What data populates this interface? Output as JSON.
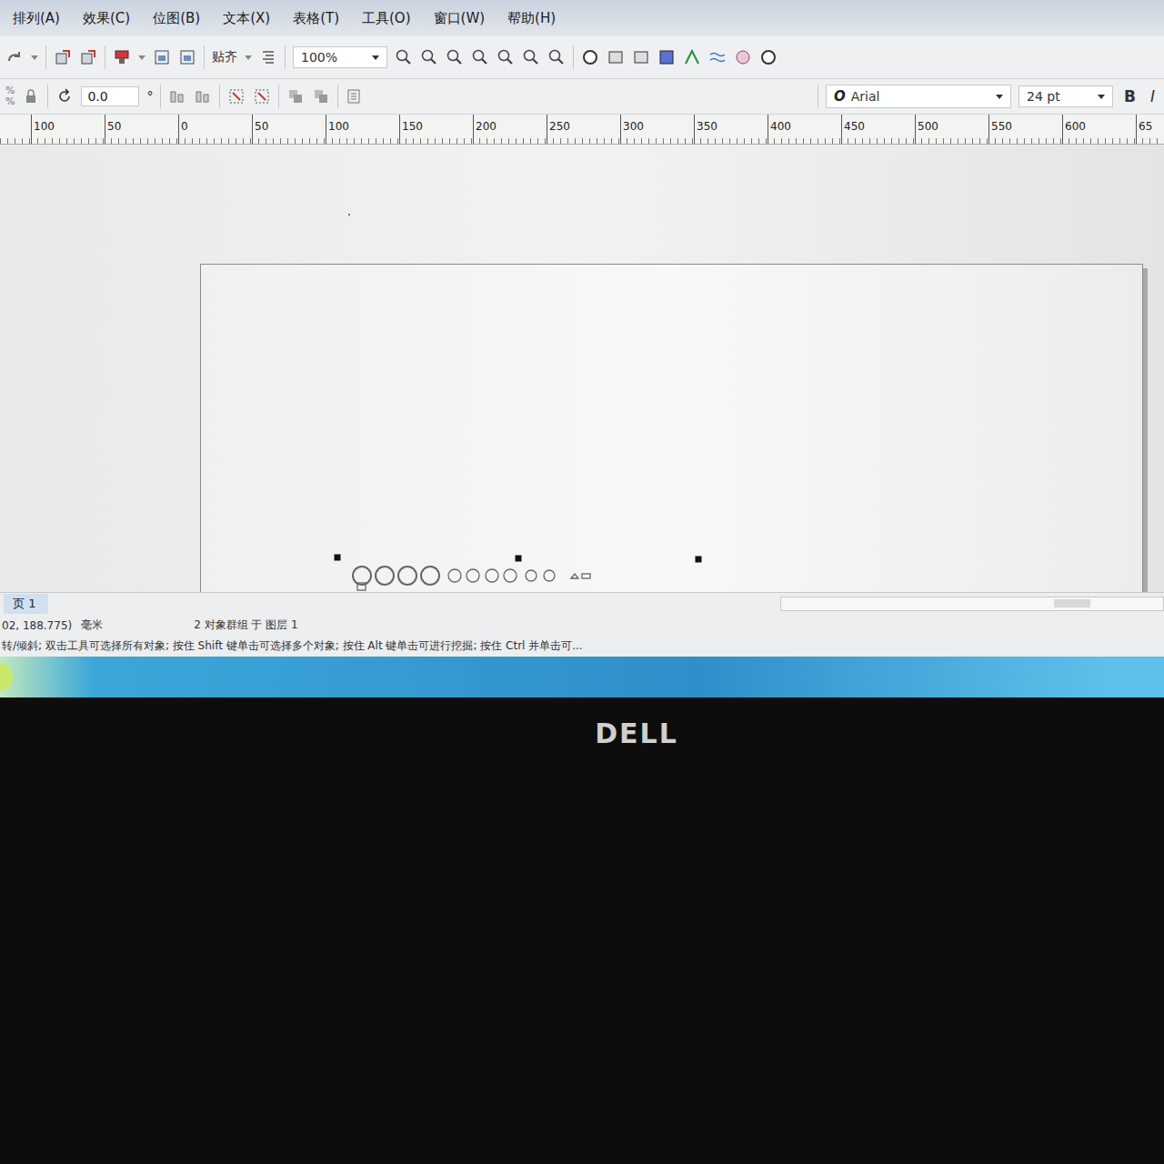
{
  "menu": [
    "排列(A)",
    "效果(C)",
    "位图(B)",
    "文本(X)",
    "表格(T)",
    "工具(O)",
    "窗口(W)",
    "帮助(H)"
  ],
  "toolbar": {
    "snap": "贴齐",
    "zoom": "100%",
    "percent": [
      "%",
      "%"
    ],
    "rotation": "0.0",
    "degree": "°",
    "font_icon": "O",
    "font": "Arial",
    "size": "24 pt",
    "bold": "B",
    "italic": "I"
  },
  "ruler": [
    "100",
    "50",
    "0",
    "50",
    "100",
    "150",
    "200",
    "250",
    "300",
    "350",
    "400",
    "450",
    "500",
    "550",
    "600",
    "65"
  ],
  "canvas": {
    "center_mark": "×"
  },
  "status": {
    "page_tab": "页 1",
    "coords": "02, 188.775)",
    "unit": "毫米",
    "selection": "2 对象群组 于 图层 1",
    "hint": "转/倾斜; 双击工具可选择所有对象; 按住 Shift 键单击可选择多个对象; 按住 Alt 键单击可进行挖掘; 按住 Ctrl 并单击可..."
  },
  "bezel": {
    "brand": "DELL"
  }
}
